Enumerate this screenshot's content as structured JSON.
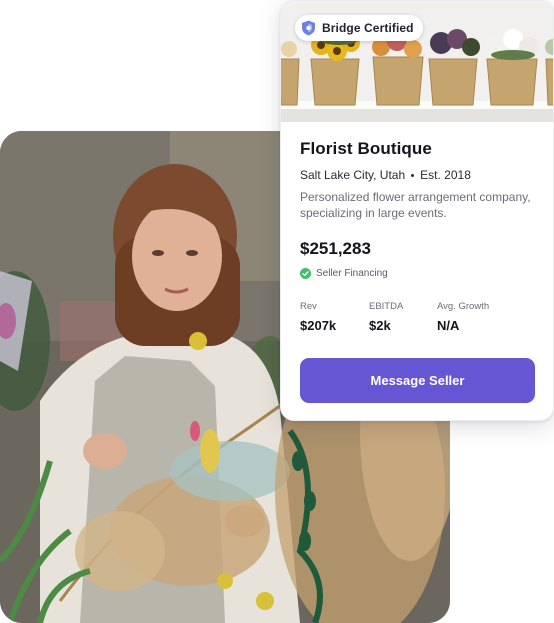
{
  "listing": {
    "badge": "Bridge Certified",
    "title": "Florist Boutique",
    "location": "Salt Lake City, Utah",
    "established": "Est. 2018",
    "description": "Personalized flower arrangement company, specializing in large events.",
    "price": "$251,283",
    "financing": "Seller Financing",
    "stats": [
      {
        "label": "Rev",
        "value": "$207k"
      },
      {
        "label": "EBITDA",
        "value": "$2k"
      },
      {
        "label": "Avg. Growth",
        "value": "N/A"
      }
    ],
    "cta": "Message Seller"
  },
  "colors": {
    "accent": "#6756d4",
    "success": "#3fbf6a",
    "badge_shield": "#6f7fe0"
  },
  "icons": {
    "badge": "shield-icon",
    "financing": "check-circle-icon"
  }
}
